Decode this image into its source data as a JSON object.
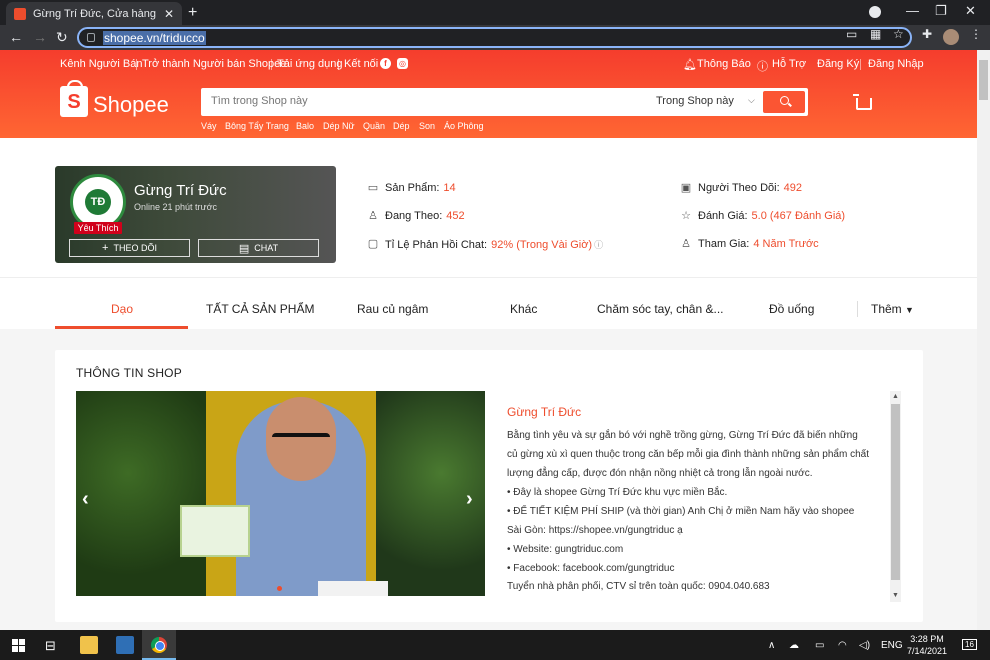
{
  "browser": {
    "tab_title": "Gừng Trí Đức, Cửa hàng trực tuyến",
    "url": "shopee.vn/triducco"
  },
  "topnav": {
    "seller_centre": "Kênh Người Bán",
    "become_seller": "Trở thành Người bán Shopee",
    "download_app": "Tải ứng dụng",
    "connect": "Kết nối",
    "notifications": "Thông Báo",
    "help": "Hỗ Trợ",
    "register": "Đăng Ký",
    "login": "Đăng Nhập"
  },
  "logo": {
    "text": "Shopee",
    "letter": "S"
  },
  "search": {
    "placeholder": "Tìm trong Shop này",
    "scope": "Trong Shop này",
    "keywords": [
      "Váy",
      "Bông Tẩy Trang",
      "Balo",
      "Dép Nữ",
      "Quần",
      "Dép",
      "Son",
      "Áo Phông"
    ]
  },
  "shop": {
    "name": "Gừng Trí Đức",
    "online": "Online 21 phút trước",
    "badge": "Yêu Thích",
    "avatar_initials": "TĐ",
    "follow_label": "THEO DÕI",
    "chat_label": "CHAT",
    "stats": {
      "products_label": "Sản Phẩm:",
      "products_value": "14",
      "following_label": "Đang Theo:",
      "following_value": "452",
      "response_label": "Tỉ Lệ Phản Hồi Chat:",
      "response_value": "92% (Trong Vài Giờ)",
      "followers_label": "Người Theo Dõi:",
      "followers_value": "492",
      "rating_label": "Đánh Giá:",
      "rating_value": "5.0 (467 Đánh Giá)",
      "joined_label": "Tham Gia:",
      "joined_value": "4 Năm Trước"
    }
  },
  "tabs": [
    "Dạo",
    "TẤT CẢ SẢN PHẨM",
    "Rau củ ngâm",
    "Khác",
    "Chăm sóc tay, chân &...",
    "Đồ uống",
    "Thêm"
  ],
  "info": {
    "title": "THÔNG TIN SHOP",
    "desc_title": "Gừng Trí Đức",
    "lines": [
      "Bằng tình yêu và sự gắn bó với nghề trồng gừng, Gừng Trí Đức đã biến những",
      "củ gừng xù xì quen thuộc trong căn bếp mỗi gia đình thành những sản phẩm chất",
      "lượng đẳng cấp, được đón nhận nồng nhiệt cả trong lẫn ngoài nước.",
      "• Đây là shopee Gừng Trí Đức khu vực miền Bắc.",
      "• ĐỂ TIẾT KIỆM PHÍ SHIP (và thời gian) Anh Chị ở miền Nam hãy vào shopee",
      "Sài Gòn: https://shopee.vn/gungtriduc ạ",
      "• Website: gungtriduc.com",
      "• Facebook: facebook.com/gungtriduc",
      "Tuyển nhà phân phối, CTV sỉ trên toàn quốc: 0904.040.683"
    ]
  },
  "taskbar": {
    "lang": "ENG",
    "time": "3:28 PM",
    "date": "7/14/2021",
    "notif_count": "16"
  }
}
